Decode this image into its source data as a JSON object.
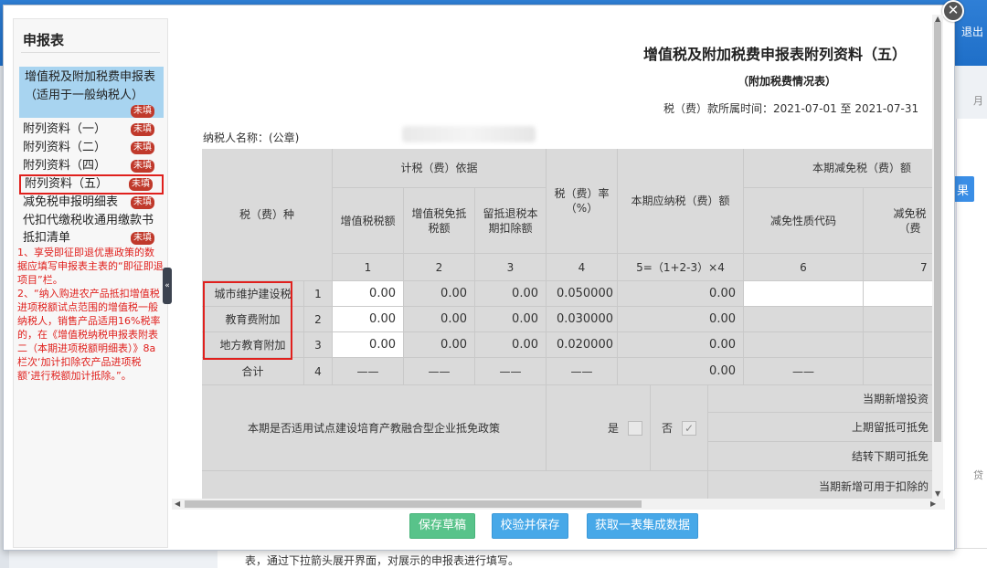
{
  "background": {
    "exit_label": "退出",
    "right_button": "果",
    "right_text_1": "月",
    "right_text_2": "贷",
    "bottom_note": "表，通过下拉箭头展开界面，对展示的申报表进行填写。"
  },
  "sidebar": {
    "title": "申报表",
    "items": [
      {
        "label": "增值税及附加税费申报表（适用于一般纳税人）",
        "badge": "未填"
      },
      {
        "label": "附列资料（一）",
        "badge": "未填"
      },
      {
        "label": "附列资料（二）",
        "badge": "未填"
      },
      {
        "label": "附列资料（四）",
        "badge": "未填"
      },
      {
        "label": "附列资料（五）",
        "badge": "未填"
      },
      {
        "label": "减免税申报明细表",
        "badge": "未填"
      },
      {
        "label": "代扣代缴税收通用缴款书",
        "badge": ""
      },
      {
        "label": "抵扣清单",
        "badge": "未填"
      }
    ],
    "note": "1、享受即征即退优惠政策的数据应填写申报表主表的“即征即退项目”栏。\n2、“纳入购进农产品抵扣增值税进项税额试点范围的增值税一般纳税人，销售产品适用16%税率的，在《增值税纳税申报表附表二（本期进项税额明细表）》8a栏次‘加计扣除农产品进项税额’进行税额加计抵除。”。"
  },
  "form": {
    "title": "增值税及附加税费申报表附列资料（五）",
    "subtitle": "（附加税费情况表）",
    "period": "税（费）款所属时间：2021-07-01 至 2021-07-31",
    "taxpayer_label": "纳税人名称：(公章)",
    "headers": {
      "tax_type": "税（费）种",
      "basis": "计税（费）依据",
      "vat_amount": "增值税税额",
      "vat_exempt": "增值税免抵税额",
      "retained_refund": "留抵退税本期扣除额",
      "rate": "税（费）率（%）",
      "payable": "本期应纳税（费）额",
      "reduction": "本期减免税（费）额",
      "reduction_code": "减免性质代码",
      "reduction_amount": "减免税（费"
    },
    "col_numbers": [
      "1",
      "2",
      "3",
      "4",
      "5=（1+2-3）×4",
      "6",
      "7"
    ],
    "rows": [
      {
        "name": "城市维护建设税",
        "no": "1",
        "c1": "0.00",
        "c2": "0.00",
        "c3": "0.00",
        "rate": "0.050000",
        "payable": "0.00"
      },
      {
        "name": "教育费附加",
        "no": "2",
        "c1": "0.00",
        "c2": "0.00",
        "c3": "0.00",
        "rate": "0.030000",
        "payable": "0.00"
      },
      {
        "name": "地方教育附加",
        "no": "3",
        "c1": "0.00",
        "c2": "0.00",
        "c3": "0.00",
        "rate": "0.020000",
        "payable": "0.00"
      }
    ],
    "total": {
      "name": "合计",
      "no": "4",
      "dash": "——",
      "payable": "0.00"
    },
    "policy": {
      "question": "本期是否适用试点建设培育产教融合型企业抵免政策",
      "yes": "是",
      "no": "否",
      "no_checked": "✓",
      "right_labels": [
        "当期新增投资",
        "上期留抵可抵免",
        "结转下期可抵免",
        "当期新增可用于扣除的"
      ]
    }
  },
  "buttons": {
    "save_draft": "保存草稿",
    "validate_save": "校验并保存",
    "fetch_data": "获取一表集成数据"
  }
}
